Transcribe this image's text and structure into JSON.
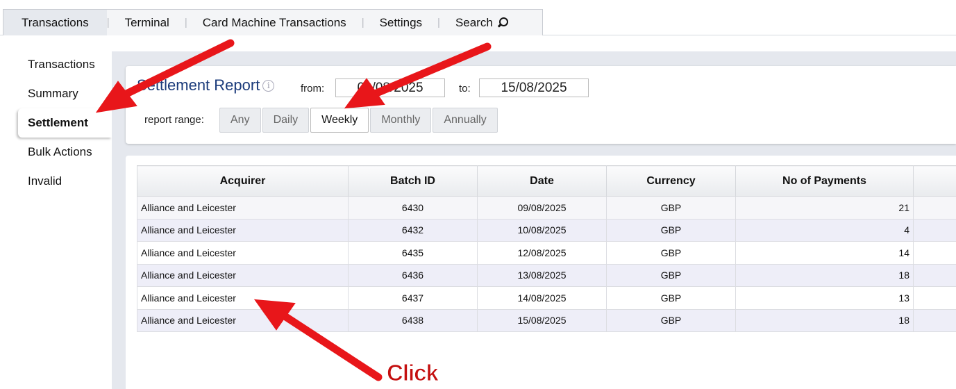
{
  "top_tabs": [
    {
      "label": "Transactions",
      "active": true
    },
    {
      "label": "Terminal",
      "active": false
    },
    {
      "label": "Card Machine Transactions",
      "active": false
    },
    {
      "label": "Settings",
      "active": false
    },
    {
      "label": "Search",
      "active": false
    }
  ],
  "sidebar": {
    "items": [
      {
        "label": "Transactions",
        "active": false
      },
      {
        "label": "Summary",
        "active": false
      },
      {
        "label": "Settlement",
        "active": true
      },
      {
        "label": "Bulk Actions",
        "active": false
      },
      {
        "label": "Invalid",
        "active": false
      }
    ]
  },
  "report": {
    "title": "Settlement Report",
    "info_glyph": "i",
    "from_label": "from:",
    "from_value": "09/08/2025",
    "to_label": "to:",
    "to_value": "15/08/2025",
    "range_label": "report range:",
    "range_options": [
      "Any",
      "Daily",
      "Weekly",
      "Monthly",
      "Annually"
    ],
    "range_selected": "Weekly"
  },
  "table": {
    "columns": [
      "Acquirer",
      "Batch ID",
      "Date",
      "Currency",
      "No of Payments"
    ],
    "rows": [
      [
        "Alliance and Leicester",
        "6430",
        "09/08/2025",
        "GBP",
        "21"
      ],
      [
        "Alliance and Leicester",
        "6432",
        "10/08/2025",
        "GBP",
        "4"
      ],
      [
        "Alliance and Leicester",
        "6435",
        "12/08/2025",
        "GBP",
        "14"
      ],
      [
        "Alliance and Leicester",
        "6436",
        "13/08/2025",
        "GBP",
        "18"
      ],
      [
        "Alliance and Leicester",
        "6437",
        "14/08/2025",
        "GBP",
        "13"
      ],
      [
        "Alliance and Leicester",
        "6438",
        "15/08/2025",
        "GBP",
        "18"
      ]
    ]
  },
  "annotation": {
    "click_text": "Click",
    "arrow_color": "#e8161a"
  },
  "colors": {
    "title_blue": "#1a3a7a",
    "panel_bg": "#e5e8ee",
    "annotation_red": "#e8161a"
  }
}
